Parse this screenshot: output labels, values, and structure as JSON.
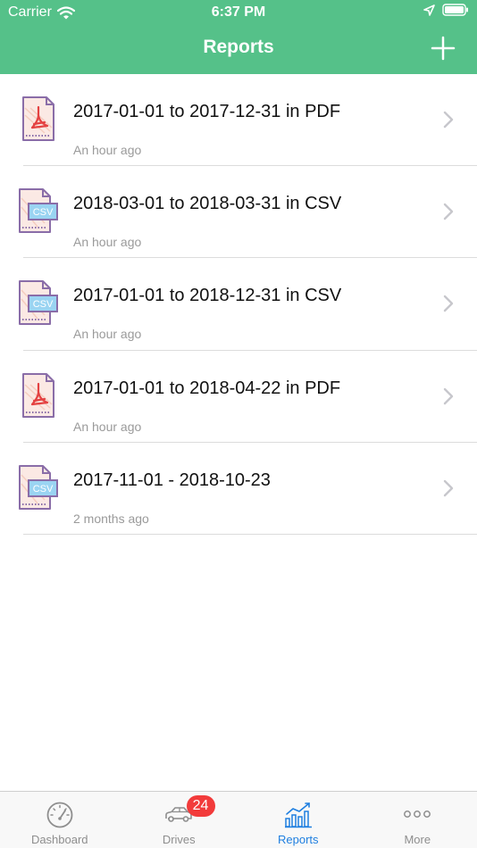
{
  "status_bar": {
    "carrier": "Carrier",
    "time": "6:37 PM"
  },
  "nav": {
    "title": "Reports"
  },
  "reports": [
    {
      "title": "2017-01-01 to 2017-12-31 in PDF",
      "time": "An hour ago",
      "format": "pdf"
    },
    {
      "title": "2018-03-01 to 2018-03-31 in CSV",
      "time": "An hour ago",
      "format": "csv"
    },
    {
      "title": "2017-01-01 to 2018-12-31 in CSV",
      "time": "An hour ago",
      "format": "csv"
    },
    {
      "title": "2017-01-01 to 2018-04-22 in PDF",
      "time": "An hour ago",
      "format": "pdf"
    },
    {
      "title": "2017-11-01 - 2018-10-23",
      "time": "2 months ago",
      "format": "csv"
    }
  ],
  "icons": {
    "csv_label": "CSV"
  },
  "tabs": [
    {
      "label": "Dashboard",
      "icon": "speedometer-icon"
    },
    {
      "label": "Drives",
      "icon": "car-icon",
      "badge": "24"
    },
    {
      "label": "Reports",
      "icon": "bar-chart-icon",
      "active": true
    },
    {
      "label": "More",
      "icon": "more-dots-icon"
    }
  ],
  "colors": {
    "header": "#55c189",
    "active_tab": "#1f7fe0",
    "badge": "#f23b3b",
    "inactive_tab": "#8e8e8e"
  }
}
